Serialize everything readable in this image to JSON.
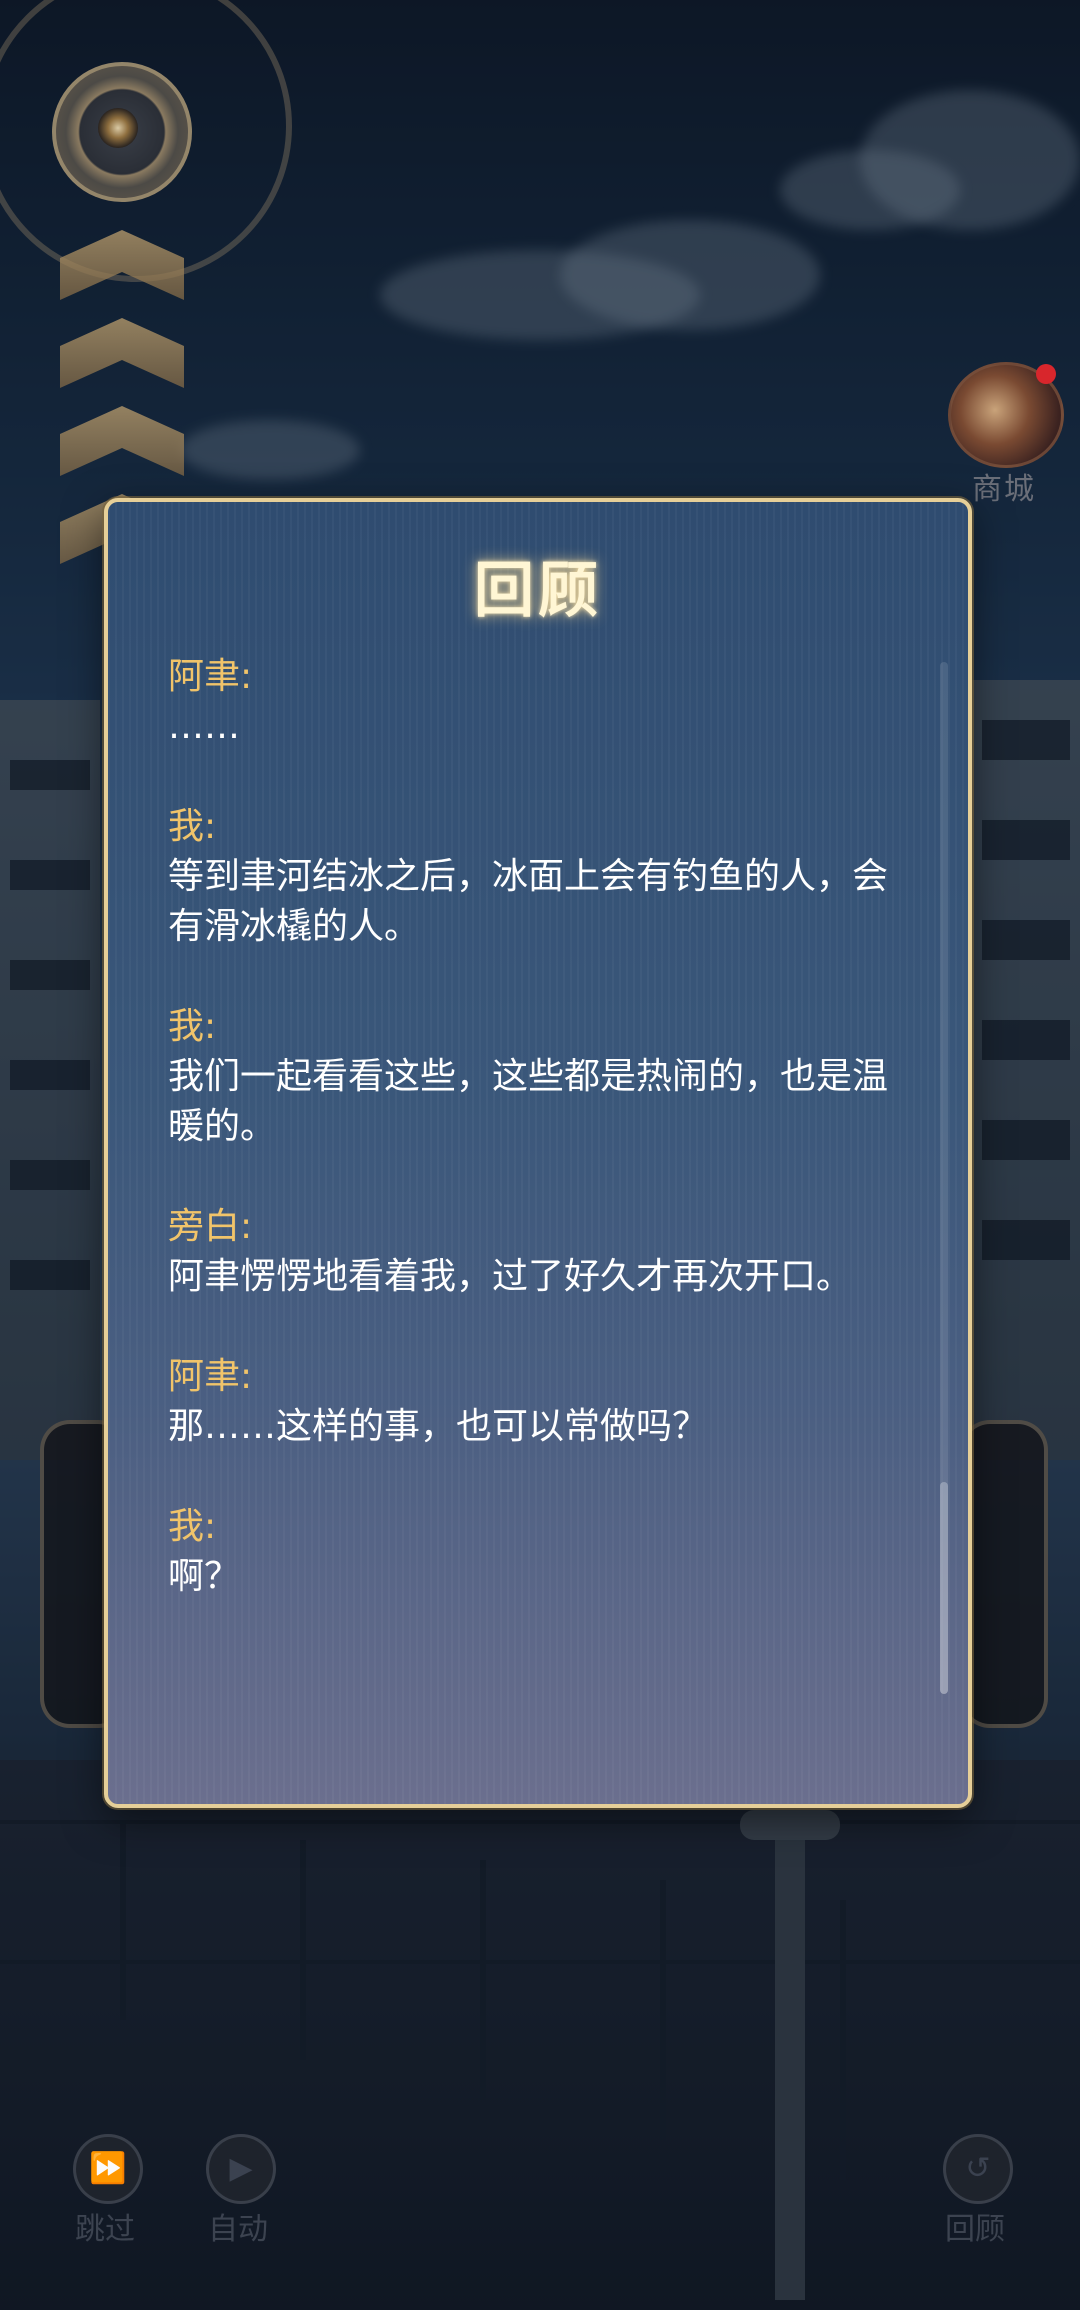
{
  "review": {
    "title": "回顾",
    "entries": [
      {
        "speaker": "阿聿:",
        "text": "……"
      },
      {
        "speaker": "我:",
        "text": "等到聿河结冰之后，冰面上会有钓鱼的人，会有滑冰橇的人。"
      },
      {
        "speaker": "我:",
        "text": "我们一起看看这些，这些都是热闹的，也是温暖的。"
      },
      {
        "speaker": "旁白:",
        "text": "阿聿愣愣地看着我，过了好久才再次开口。"
      },
      {
        "speaker": "阿聿:",
        "text": "那……这样的事，也可以常做吗？"
      },
      {
        "speaker": "我:",
        "text": "啊？"
      }
    ]
  },
  "shop": {
    "label": "商城"
  },
  "controls": {
    "skip": {
      "label": "跳过",
      "icon": "fast-forward-icon"
    },
    "auto": {
      "label": "自动",
      "icon": "play-icon"
    },
    "review": {
      "label": "回顾",
      "icon": "history-icon"
    }
  }
}
